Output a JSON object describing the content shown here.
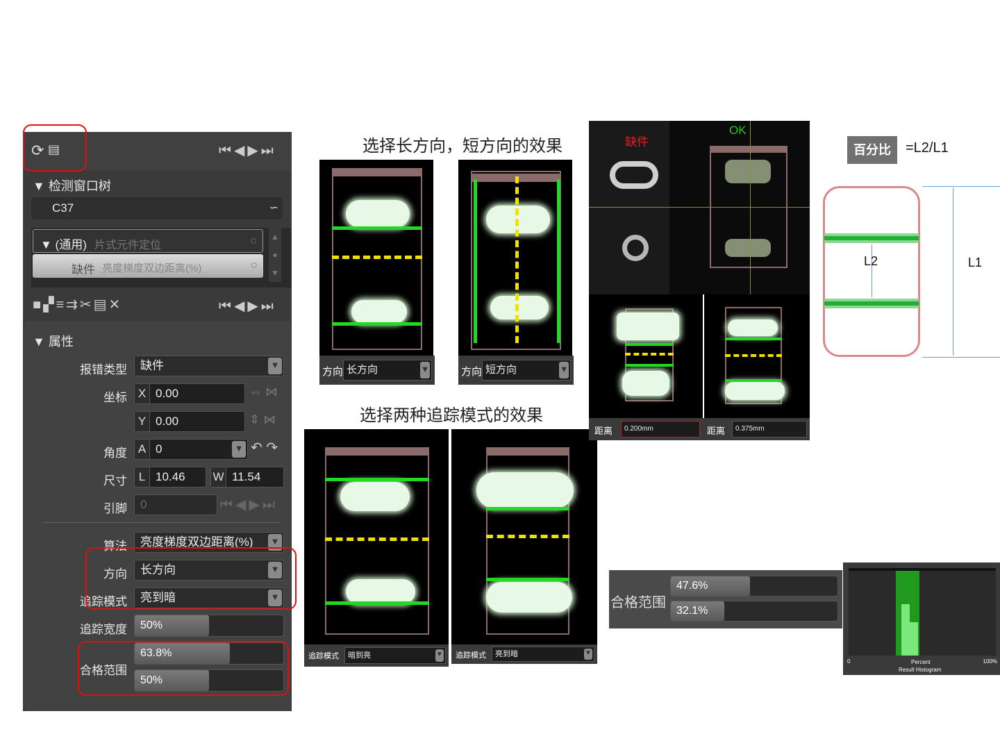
{
  "panel": {
    "tree_title": "▼ 检测窗口树",
    "component": "C37",
    "item1_label": "▼ (通用)",
    "item1_desc": "片式元件定位",
    "item2_label": "缺件",
    "item2_desc": "亮度梯度双边距离(%)",
    "props_title": "▼ 属性",
    "error_type_label": "报错类型",
    "error_type_value": "缺件",
    "coord_label": "坐标",
    "x_prefix": "X",
    "x_value": "0.00",
    "y_prefix": "Y",
    "y_value": "0.00",
    "angle_label": "角度",
    "angle_prefix": "A",
    "angle_value": "0",
    "size_label": "尺寸",
    "l_prefix": "L",
    "l_value": "10.46",
    "w_prefix": "W",
    "w_value": "11.54",
    "pin_label": "引脚",
    "pin_value": "0",
    "algo_label": "算法",
    "algo_value": "亮度梯度双边距离(%)",
    "dir_label": "方向",
    "dir_value": "长方向",
    "track_label": "追踪模式",
    "track_value": "亮到暗",
    "width_label": "追踪宽度",
    "width_value": "50%",
    "width_fill": 0.5,
    "range_label": "合格范围",
    "range_a": "63.8%",
    "range_a_fill": 0.638,
    "range_b": "50%",
    "range_b_fill": 0.5
  },
  "captions": {
    "direction": "选择长方向，短方向的效果",
    "tracking": "选择两种追踪模式的效果"
  },
  "dir_shots": [
    {
      "label": "方向",
      "value": "长方向"
    },
    {
      "label": "方向",
      "value": "短方向"
    }
  ],
  "track_shots": [
    {
      "label": "追踪模式",
      "value": "暗到亮"
    },
    {
      "label": "追踪模式",
      "value": "亮到暗"
    }
  ],
  "defect_shot": {
    "missing": "缺件",
    "ok": "OK",
    "dist_label": "距离",
    "dist_a": "0.200mm",
    "dist_b": "0.375mm"
  },
  "percent": {
    "badge": "百分比",
    "formula": "=L2/L1",
    "l1": "L1",
    "l2": "L2"
  },
  "range_widget": {
    "label": "合格范围",
    "a": "47.6%",
    "a_fill": 0.476,
    "b": "32.1%",
    "b_fill": 0.321
  },
  "histogram": {
    "left": "0",
    "right": "100%",
    "axis": "Percent",
    "title": "Result Histogram"
  },
  "colors": {
    "highlight": "#e01010",
    "green_line": "#22d822",
    "yellow_dash": "#f2e000"
  }
}
